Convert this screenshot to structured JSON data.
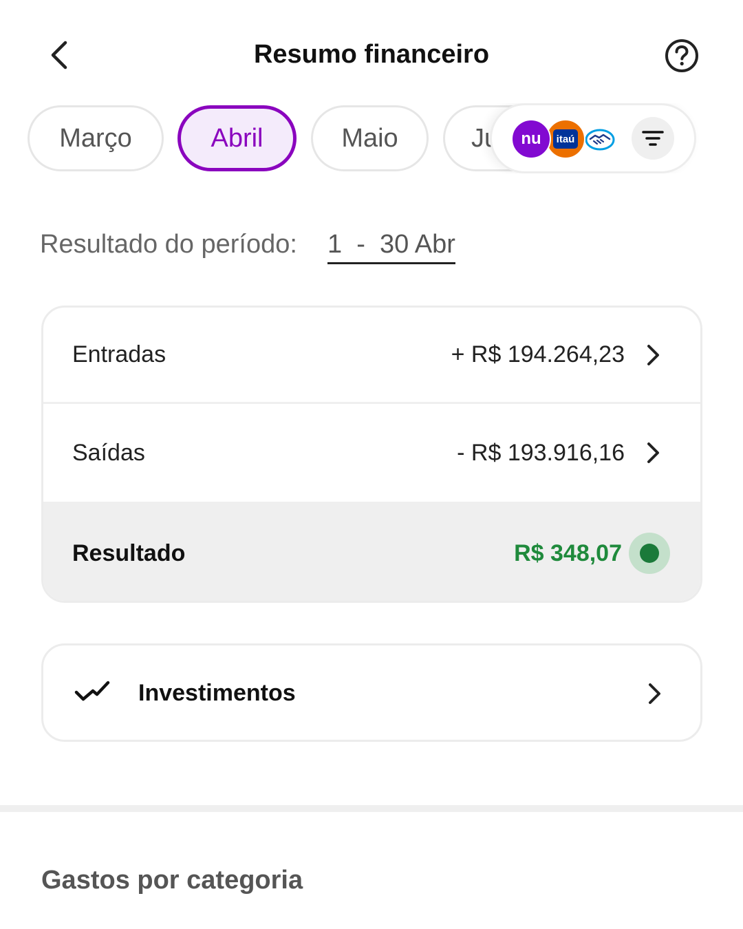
{
  "header": {
    "title": "Resumo financeiro",
    "back_icon": "chevron-left-icon",
    "help_icon": "question-circle-icon"
  },
  "months": [
    {
      "label": "Março",
      "selected": false
    },
    {
      "label": "Abril",
      "selected": true
    },
    {
      "label": "Maio",
      "selected": false
    },
    {
      "label": "Ju",
      "selected": false
    }
  ],
  "bank_filter": {
    "banks": [
      {
        "name": "nubank",
        "logo_text": "nu",
        "color": "#820ad1"
      },
      {
        "name": "itau",
        "logo_text": "itaú",
        "color": "#ec7000"
      },
      {
        "name": "mercado-pago",
        "logo_text": "",
        "color": "#00b1ea"
      }
    ],
    "filter_icon": "filter-icon"
  },
  "period": {
    "label": "Resultado do período:",
    "range": "1  -  30 Abr"
  },
  "summary": {
    "entradas": {
      "label": "Entradas",
      "value": "+ R$ 194.264,23"
    },
    "saidas": {
      "label": "Saídas",
      "value": "- R$ 193.916,16"
    },
    "resultado": {
      "label": "Resultado",
      "value": "R$ 348,07",
      "status_color": "#1b7a3a"
    }
  },
  "investimentos": {
    "label": "Investimentos",
    "icon": "trend-check-icon"
  },
  "section": {
    "title": "Gastos por categoria"
  },
  "colors": {
    "accent": "#8a05be",
    "positive": "#1f8a3c"
  }
}
